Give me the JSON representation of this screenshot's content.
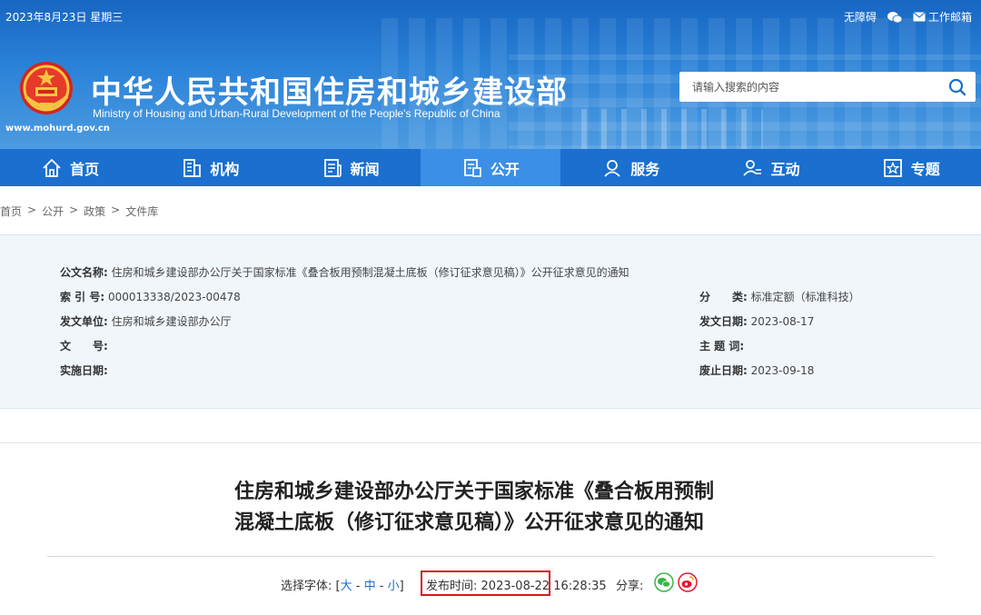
{
  "topbar": {
    "date": "2023年8月23日 星期三",
    "accessibility": "无障碍",
    "mail": "工作邮箱"
  },
  "header": {
    "url": "www.mohurd.gov.cn",
    "title": "中华人民共和国住房和城乡建设部",
    "subtitle": "Ministry of Housing and Urban-Rural Development of the People's Republic of China",
    "search_placeholder": "请输入搜索的内容"
  },
  "nav": {
    "items": [
      {
        "label": "首页",
        "icon": "home-icon"
      },
      {
        "label": "机构",
        "icon": "building-icon"
      },
      {
        "label": "新闻",
        "icon": "news-icon"
      },
      {
        "label": "公开",
        "icon": "document-icon"
      },
      {
        "label": "服务",
        "icon": "service-icon"
      },
      {
        "label": "互动",
        "icon": "interact-icon"
      },
      {
        "label": "专题",
        "icon": "star-icon"
      }
    ],
    "active_index": 3
  },
  "breadcrumb": [
    "首页",
    "公开",
    "政策",
    "文件库"
  ],
  "info": {
    "name_key": "公文名称:",
    "name_val": "住房和城乡建设部办公厅关于国家标准《叠合板用预制混凝土底板（修订征求意见稿）》公开征求意见的通知",
    "index_key": "索 引 号:",
    "index_val": "000013338/2023-00478",
    "issuer_key": "发文单位:",
    "issuer_val": "住房和城乡建设部办公厅",
    "docno_key": "文　　号:",
    "docno_val": "",
    "impl_key": "实施日期:",
    "impl_val": "",
    "category_key": "分　　类:",
    "category_val": "标准定额（标准科技）",
    "date_key": "发文日期:",
    "date_val": "2023-08-17",
    "subject_key": "主 题 词:",
    "subject_val": "",
    "expire_key": "废止日期:",
    "expire_val": "2023-09-18"
  },
  "article": {
    "title_line1": "住房和城乡建设部办公厅关于国家标准《叠合板用预制",
    "title_line2": "混凝土底板（修订征求意见稿）》公开征求意见的通知",
    "font_label": "选择字体:",
    "font_open": "[",
    "font_large": "大",
    "font_sep1": " - ",
    "font_medium": "中",
    "font_sep2": " - ",
    "font_small": "小",
    "font_close": "]",
    "pub_label": "发布时间:",
    "pub_date": "2023-08-22",
    "pub_time": "16:28:35",
    "share_label": "分享:"
  },
  "colors": {
    "nav_bg": "#1a6fcf",
    "nav_active": "#3b8fe6",
    "highlight_box": "#d61a1a",
    "wechat": "#3bb34a",
    "weibo": "#e6162d"
  }
}
